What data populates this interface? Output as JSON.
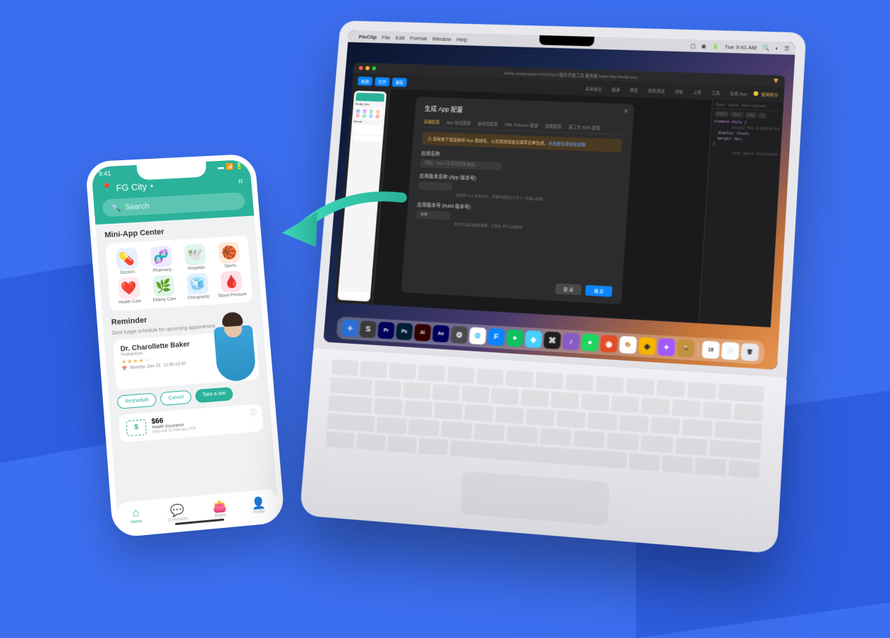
{
  "phone": {
    "status_time": "9:41",
    "location_label": "FG City",
    "search_placeholder": "Search",
    "mini_app_center_title": "Mini-App Center",
    "categories": [
      {
        "label": "Doctors",
        "emoji": "💊",
        "bg": "#e8efff"
      },
      {
        "label": "Pharmacy",
        "emoji": "🧬",
        "bg": "#f0e8ff"
      },
      {
        "label": "Hospitals",
        "emoji": "🕊️",
        "bg": "#e0f5f0"
      },
      {
        "label": "Sports",
        "emoji": "🏀",
        "bg": "#ffe8d8"
      },
      {
        "label": "Health Care",
        "emoji": "❤️",
        "bg": "#ffe8ec"
      },
      {
        "label": "Elderly Care",
        "emoji": "🌿",
        "bg": "#e0f5ea"
      },
      {
        "label": "Chiropractic",
        "emoji": "🧊",
        "bg": "#e0f0ff"
      },
      {
        "label": "Blood Pressure",
        "emoji": "🩸",
        "bg": "#ffe0e8"
      }
    ],
    "reminder_title": "Reminder",
    "reminder_sub": "Dont forget schedule for upcoming appointment",
    "doctor": {
      "name": "Dr. Charollette Baker",
      "role": "Pediatrician",
      "date": "Monday, Dec 23",
      "time": "12:00-13:00"
    },
    "actions": {
      "reschedule": "Reshedule",
      "cancel": "Cancel",
      "take_taxi": "Take a taxi"
    },
    "insurance": {
      "price": "$66",
      "line": "Health Insurance",
      "valid": "Valid until 01 February 2024"
    },
    "nav": [
      {
        "label": "Home"
      },
      {
        "label": "Comments"
      },
      {
        "label": "Wallet"
      },
      {
        "label": "Profile"
      }
    ]
  },
  "laptop": {
    "menubar": {
      "app": "FinClip",
      "items": [
        "File",
        "Edit",
        "Format",
        "Window",
        "Help"
      ],
      "time": "Tue 9:41 AM"
    },
    "window": {
      "title": "finclip-miniprogram4-FinClip小程序开发工具 服务器 https://api.finclip.com",
      "toolbar_tabs": [
        "新建",
        "打开",
        "保存"
      ],
      "toolbar_right_tabs": [
        "基本信息",
        "编译",
        "预览",
        "真机调试",
        "详情",
        "上传",
        "工具",
        "生成 App"
      ],
      "credit_label": "使用积分"
    },
    "modal": {
      "title": "生成 App 配置",
      "tabs": [
        "基础配置",
        "App 信息配置",
        "启动页配置",
        "URL Scheme 配置",
        "权限配置",
        "第三方 SDK 配置"
      ],
      "warning_prefix": "⚠ 您尚未下载最新的 App 离线包，以无离线包信息填写表单生成，",
      "warning_link": "点击前往离线包说明",
      "fields": {
        "app_name_label": "应用名称",
        "app_name_placeholder": "例如：App (不可与已有重名)",
        "app_version_label": "应用版本名称 (App 版本号)",
        "app_version_value": "",
        "app_version_hint": "请使用 x.y.z 方式命名，升级时请保证大于上一次输入的值",
        "build_version_label": "应用版本号 (build 版本号)",
        "build_version_value": "100",
        "build_version_hint": "首次默认建议版本配置，后续由 IDE 自动更新"
      },
      "cancel": "取 消",
      "confirm": "确 定"
    },
    "side_panel": {
      "tabs": [
        "Styles",
        "Layout",
        "Event Listeners"
      ],
      "filter_label": "Filter",
      "hov": ":hov",
      "cls": ".cls",
      "plus": "+",
      "style_line": "element.style {",
      "display": "display: block;",
      "margins": "margin: 0px;",
      "sheet_line": "style2.fI6.4c106fc6:18",
      "agent": "user agent stylesheet"
    },
    "dock": [
      {
        "bg": "#2a6fd6",
        "char": "✧"
      },
      {
        "bg": "#3a3a3c",
        "char": "S"
      },
      {
        "bg": "#00005b",
        "char": "Pr"
      },
      {
        "bg": "#001e36",
        "char": "Ps"
      },
      {
        "bg": "#330000",
        "char": "Ai"
      },
      {
        "bg": "#00005b",
        "char": "Ae"
      },
      {
        "bg": "#4a4a4c",
        "char": "⚙"
      },
      {
        "bg": "#ffffff",
        "char": "🌐"
      },
      {
        "bg": "#0a84ff",
        "char": "F"
      },
      {
        "bg": "#0ec160",
        "char": "●"
      },
      {
        "bg": "#44d1fd",
        "char": "◈"
      },
      {
        "bg": "#1e1e1e",
        "char": "⌘"
      },
      {
        "bg": "#8a5cc4",
        "char": "♪"
      },
      {
        "bg": "#1ed760",
        "char": "●"
      },
      {
        "bg": "#e44d26",
        "char": "◉"
      },
      {
        "bg": "#ffffff",
        "char": "🎨"
      },
      {
        "bg": "#f7b500",
        "char": "◆"
      },
      {
        "bg": "#a259ff",
        "char": "✦"
      },
      {
        "bg": "#c2923e",
        "char": "📦"
      },
      {
        "bg": "#ffffff",
        "char": "18"
      },
      {
        "bg": "#ffffff",
        "char": "📄"
      },
      {
        "bg": "#e8e8ec",
        "char": "🗑"
      }
    ]
  }
}
